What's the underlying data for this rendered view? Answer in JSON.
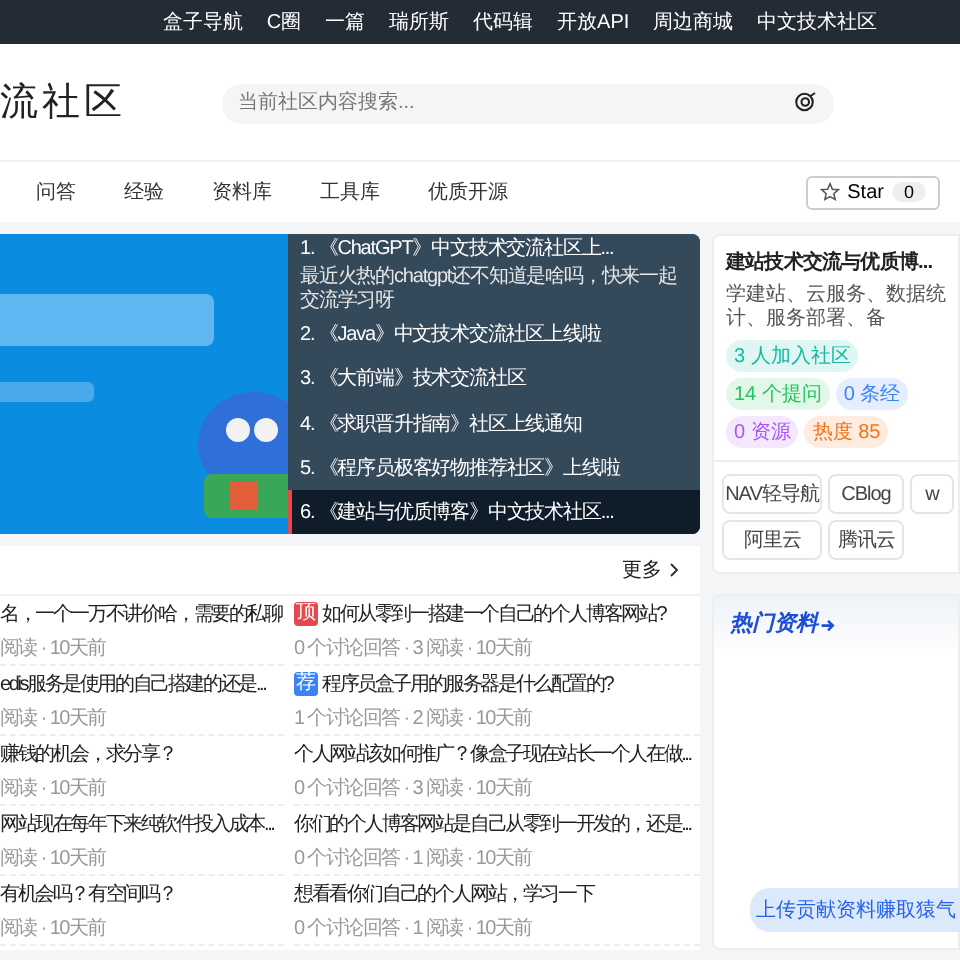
{
  "top_links": [
    "盒子导航",
    "C圈",
    "一篇",
    "瑞所斯",
    "代码辑",
    "开放API",
    "周边商城",
    "中文技术社区"
  ],
  "header": {
    "logo": "流社区",
    "search": {
      "placeholder": "当前社区内容搜索..."
    }
  },
  "nav": {
    "items": [
      "问答",
      "经验",
      "资料库",
      "工具库",
      "优质开源"
    ],
    "star": {
      "label": "Star",
      "count": "0"
    }
  },
  "banner": {
    "kind": "picture",
    "list": [
      {
        "title": "1. 《ChatGPT》中文技术交流社区上...",
        "desc": "最近火热的chatgpt还不知道是啥吗，快来一起交流学习呀",
        "selected": false
      },
      {
        "title": "2. 《Java》中文技术交流社区上线啦",
        "selected": false
      },
      {
        "title": "3. 《大前端》技术交流社区",
        "selected": false
      },
      {
        "title": "4. 《求职晋升指南》社区上线通知",
        "selected": false
      },
      {
        "title": "5. 《程序员极客好物推荐社区》上线啦",
        "selected": false
      },
      {
        "title": "6. 《建站与优质博客》中文技术社区...",
        "selected": true
      }
    ]
  },
  "questions": {
    "more": "更多",
    "columns": [
      [
        {
          "title": "名，一个一万不讲价哈，需要的私聊",
          "meta": "阅读 · 10天前"
        },
        {
          "title": "edis服务是使用的自己搭建的还是...",
          "meta": "阅读 · 10天前"
        },
        {
          "title": "赚钱的机会，求分享？",
          "meta": "阅读 · 10天前"
        },
        {
          "title": "网站现在每年下来纯软件投入成本...",
          "meta": "阅读 · 10天前"
        },
        {
          "title": "有机会吗？有空间吗？",
          "meta": "阅读 · 10天前"
        }
      ],
      [
        {
          "badge": {
            "label": "顶",
            "color": "#e5484d"
          },
          "title": "如何从零到一搭建一个自己的个人博客网站?",
          "meta": "0 个讨论回答 · 3 阅读 · 10天前"
        },
        {
          "badge": {
            "label": "荐",
            "color": "#3b82f6"
          },
          "title": "程序员盒子用的服务器是什么配置的?",
          "meta": "1 个讨论回答 · 2 阅读 · 10天前"
        },
        {
          "title": "个人网站该如何推广？像盒子现在站长一个人在做...",
          "meta": "0 个讨论回答 · 3 阅读 · 10天前"
        },
        {
          "title": "你们的个人博客网站是自己从零到一开发的，还是...",
          "meta": "0 个讨论回答 · 1 阅读 · 10天前"
        },
        {
          "title": "想看看你们自己的个人网站，学习一下",
          "meta": "0 个讨论回答 · 1 阅读 · 10天前"
        }
      ]
    ]
  },
  "community": {
    "title": "建站技术交流与优质博...",
    "desc": "学建站、云服务、数据统计、服务部署、备",
    "tags": [
      {
        "label": "3 人加入社区",
        "color": "#14b8a6"
      },
      {
        "label": "14 个提问",
        "color": "#22c55e"
      },
      {
        "label": "0 条经",
        "color": "#3b82f6"
      },
      {
        "label": "0 资源",
        "color": "#a855f7"
      },
      {
        "label": "热度 85",
        "color": "#f97316"
      }
    ],
    "links": [
      "NAV轻导航",
      "CBlog",
      "w",
      "阿里云",
      "腾讯云"
    ]
  },
  "hot": {
    "title": "热门资料",
    "button": "上传贡献资料赚取猿气"
  }
}
